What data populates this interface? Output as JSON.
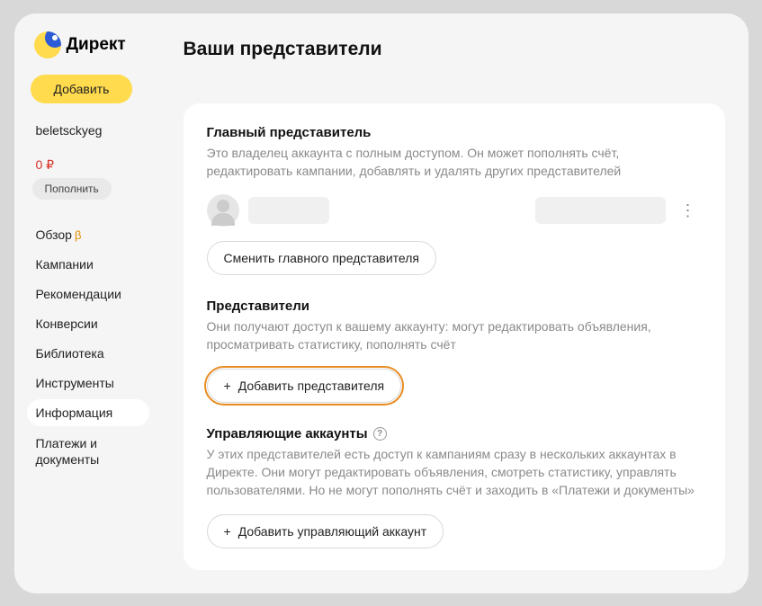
{
  "brand": "Директ",
  "sidebar": {
    "add_button": "Добавить",
    "username": "beletsckyeg",
    "balance": "0 ₽",
    "topup": "Пополнить",
    "nav": {
      "overview": "Обзор",
      "overview_beta": "β",
      "campaigns": "Кампании",
      "recommend": "Рекомендации",
      "conversions": "Конверсии",
      "library": "Библиотека",
      "tools": "Инструменты",
      "info": "Информация",
      "payments": "Платежи и документы"
    }
  },
  "page": {
    "title": "Ваши представители",
    "main_rep": {
      "title": "Главный представитель",
      "desc": "Это владелец аккаунта с полным доступом. Он может пополнять счёт, редактировать кампании, добавлять и удалять других представителей",
      "change_btn": "Сменить главного представителя"
    },
    "reps": {
      "title": "Представители",
      "desc": "Они получают доступ к вашему аккаунту: могут редактировать объявления, просматривать статистику, пополнять счёт",
      "add_btn": "Добавить представителя"
    },
    "mgr": {
      "title": "Управляющие аккаунты",
      "desc": "У этих представителей есть доступ к кампаниям сразу в нескольких аккаунтах в Директе. Они могут редактировать объявления, смотреть статистику, управлять пользователями. Но не могут пополнять счёт и заходить в «Платежи и документы»",
      "add_btn": "Добавить управляющий аккаунт"
    }
  },
  "icons": {
    "plus": "+",
    "help": "?",
    "dots": "⋮"
  }
}
